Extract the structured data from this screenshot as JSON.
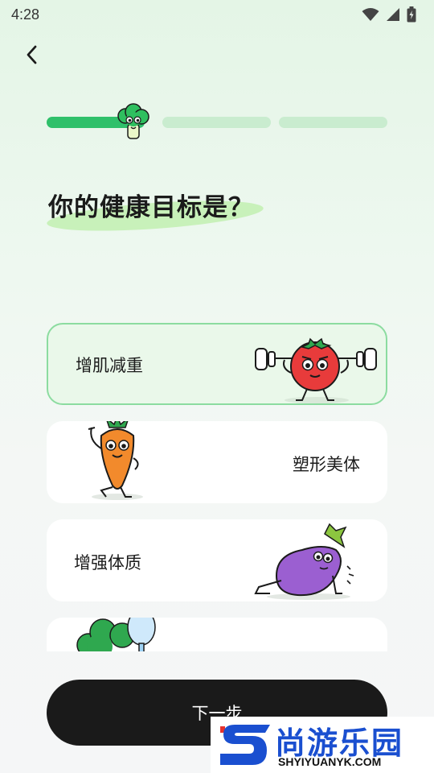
{
  "status_bar": {
    "time": "4:28",
    "icons": [
      "wifi-icon",
      "cellular-signal-icon",
      "battery-charging-icon"
    ]
  },
  "nav": {
    "back_icon": "chevron-left-icon"
  },
  "progress": {
    "current_step": 1,
    "total_steps": 3,
    "fraction_of_first_step": 0.7,
    "mascot": "broccoli-mascot"
  },
  "page": {
    "title": "你的健康目标是？"
  },
  "options": [
    {
      "label": "增肌减重",
      "selected": true,
      "illustration": "tomato-weightlifting"
    },
    {
      "label": "塑形美体",
      "selected": false,
      "illustration": "carrot-posing"
    },
    {
      "label": "增强体质",
      "selected": false,
      "illustration": "eggplant-pushup"
    },
    {
      "label": "",
      "selected": false,
      "illustration": "broccoli-with-mirror"
    }
  ],
  "footer": {
    "next_label": "下一步"
  },
  "watermark": {
    "cn": "尚游乐园",
    "en": "SHYIYUANYK.COM"
  },
  "colors": {
    "accent_green": "#2fc06a",
    "progress_track": "#c9eccf",
    "selected_border": "#8cdca0",
    "selected_bg": "#eaf8ea",
    "button_bg": "#1a1a1a",
    "watermark_blue": "#1a4fd0"
  }
}
